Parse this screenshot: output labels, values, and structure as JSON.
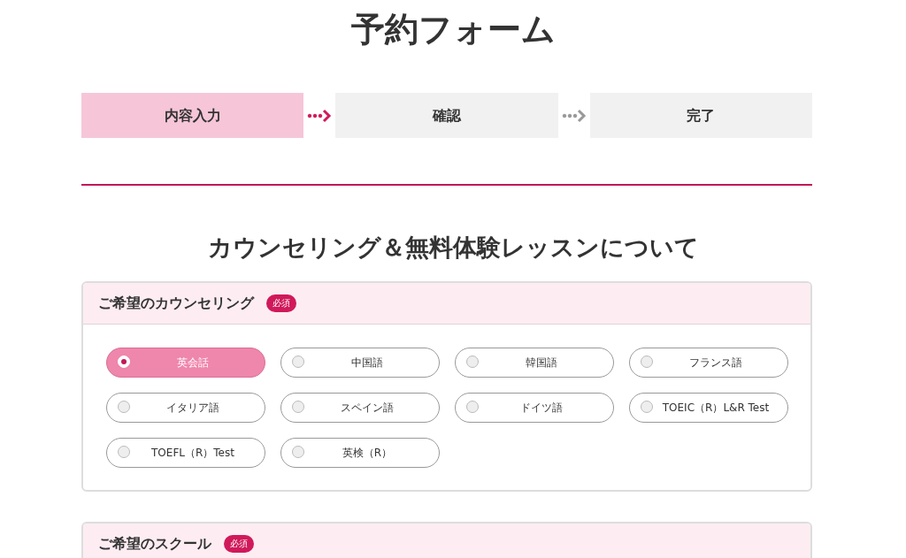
{
  "page_title": "予約フォーム",
  "steps": [
    {
      "label": "内容入力",
      "selected": true
    },
    {
      "label": "確認",
      "selected": false
    },
    {
      "label": "完了",
      "selected": false
    }
  ],
  "section_heading": "カウンセリング＆無料体験レッスンについて",
  "fields": [
    {
      "label": "ご希望のカウンセリング",
      "badge": "必須",
      "options": [
        {
          "label": "英会話",
          "selected": true
        },
        {
          "label": "中国語",
          "selected": false
        },
        {
          "label": "韓国語",
          "selected": false
        },
        {
          "label": "フランス語",
          "selected": false
        },
        {
          "label": "イタリア語",
          "selected": false
        },
        {
          "label": "スペイン語",
          "selected": false
        },
        {
          "label": "ドイツ語",
          "selected": false
        },
        {
          "label": "TOEIC（R）L&R Test",
          "selected": false
        },
        {
          "label": "TOEFL（R）Test",
          "selected": false
        },
        {
          "label": "英検（R）",
          "selected": false
        }
      ]
    },
    {
      "label": "ご希望のスクール",
      "badge": "必須"
    }
  ]
}
